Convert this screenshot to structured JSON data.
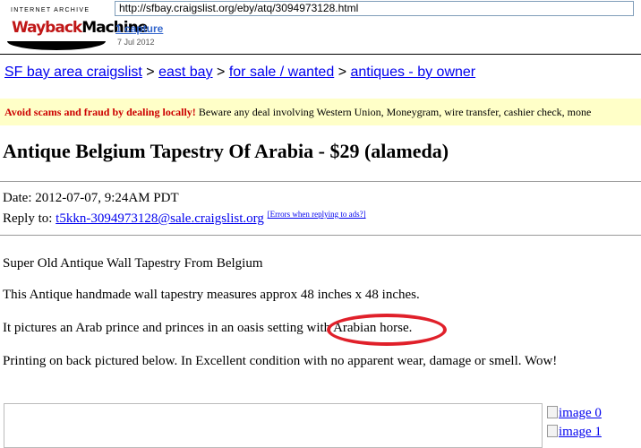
{
  "wayback": {
    "logo_top": "INTERNET ARCHIVE",
    "logo_w1": "Wayback",
    "logo_w2": "Machine",
    "url": "http://sfbay.craigslist.org/eby/atq/3094973128.html",
    "captures": "1 capture",
    "date": "7 Jul 2012"
  },
  "breadcrumb": {
    "items": [
      "SF bay area craigslist",
      "east bay",
      "for sale / wanted",
      "antiques - by owner"
    ],
    "separator": ">"
  },
  "scam": {
    "warning": "Avoid scams and fraud by dealing locally!",
    "text": " Beware any deal involving Western Union, Moneygram, wire transfer, cashier check, mone"
  },
  "post": {
    "title": "Antique Belgium Tapestry Of Arabia - $29 (alameda)",
    "date_label": "Date: 2012-07-07, 9:24AM PDT",
    "reply_label": "Reply to: ",
    "reply_email": "t5kkn-3094973128@sale.craigslist.org",
    "errors_link": "[Errors when replying to ads?]",
    "paragraphs": [
      "Super Old Antique Wall Tapestry From Belgium",
      "This Antique handmade wall tapestry measures approx 48 inches x 48 inches.",
      "It pictures an Arab prince and princes in an oasis setting with Arabian horse.",
      "Printing on back pictured below. In Excellent condition with no apparent wear, damage or smell. Wow!"
    ]
  },
  "images": [
    "image 0",
    "image 1"
  ],
  "colors": {
    "annotation": "#e0202a",
    "link": "#0000ee",
    "banner_bg": "#ffffc8"
  }
}
